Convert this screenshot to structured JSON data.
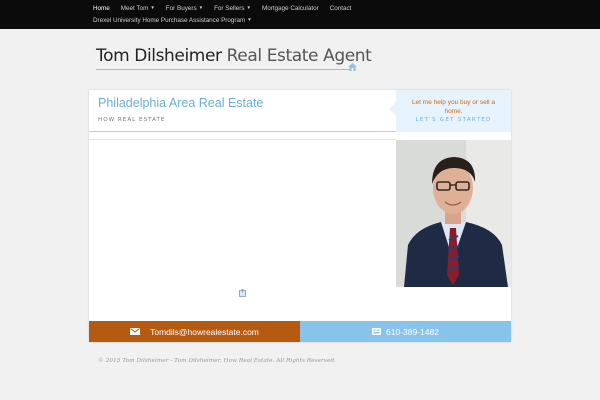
{
  "nav": {
    "row1": [
      {
        "label": "Home",
        "active": true,
        "dropdown": false
      },
      {
        "label": "Meet Tom",
        "active": false,
        "dropdown": true
      },
      {
        "label": "For Buyers",
        "active": false,
        "dropdown": true
      },
      {
        "label": "For Sellers",
        "active": false,
        "dropdown": true
      },
      {
        "label": "Mortgage Calculator",
        "active": false,
        "dropdown": false
      },
      {
        "label": "Contact",
        "active": false,
        "dropdown": false
      }
    ],
    "row2": [
      {
        "label": "Drexel University Home Purchase Assistance Program",
        "active": false,
        "dropdown": true
      }
    ],
    "caret_glyph": "▼"
  },
  "header": {
    "name": "Tom Dilsheimer",
    "role": "Real Estate Agent"
  },
  "panel": {
    "title": "Philadelphia Area Real Estate",
    "subtitle": "HOW REAL ESTATE",
    "cta_text": "Let me help you buy or sell a home.",
    "cta_link": "LET'S GET STARTED"
  },
  "contact": {
    "email": "Tomdils@howrealestate.com",
    "phone": "610-389-1482",
    "email_icon": "envelope-icon",
    "phone_icon": "phone-icon"
  },
  "footer": {
    "text": "© 2015 Tom Dilsheimer - Tom Dilsheimer, How Real Estate. All Rights Reserved."
  },
  "colors": {
    "nav_bg": "#0b0b0b",
    "accent_blue": "#6aaed6",
    "accent_orange": "#b65a12",
    "phone_bar": "#88c3ec"
  }
}
